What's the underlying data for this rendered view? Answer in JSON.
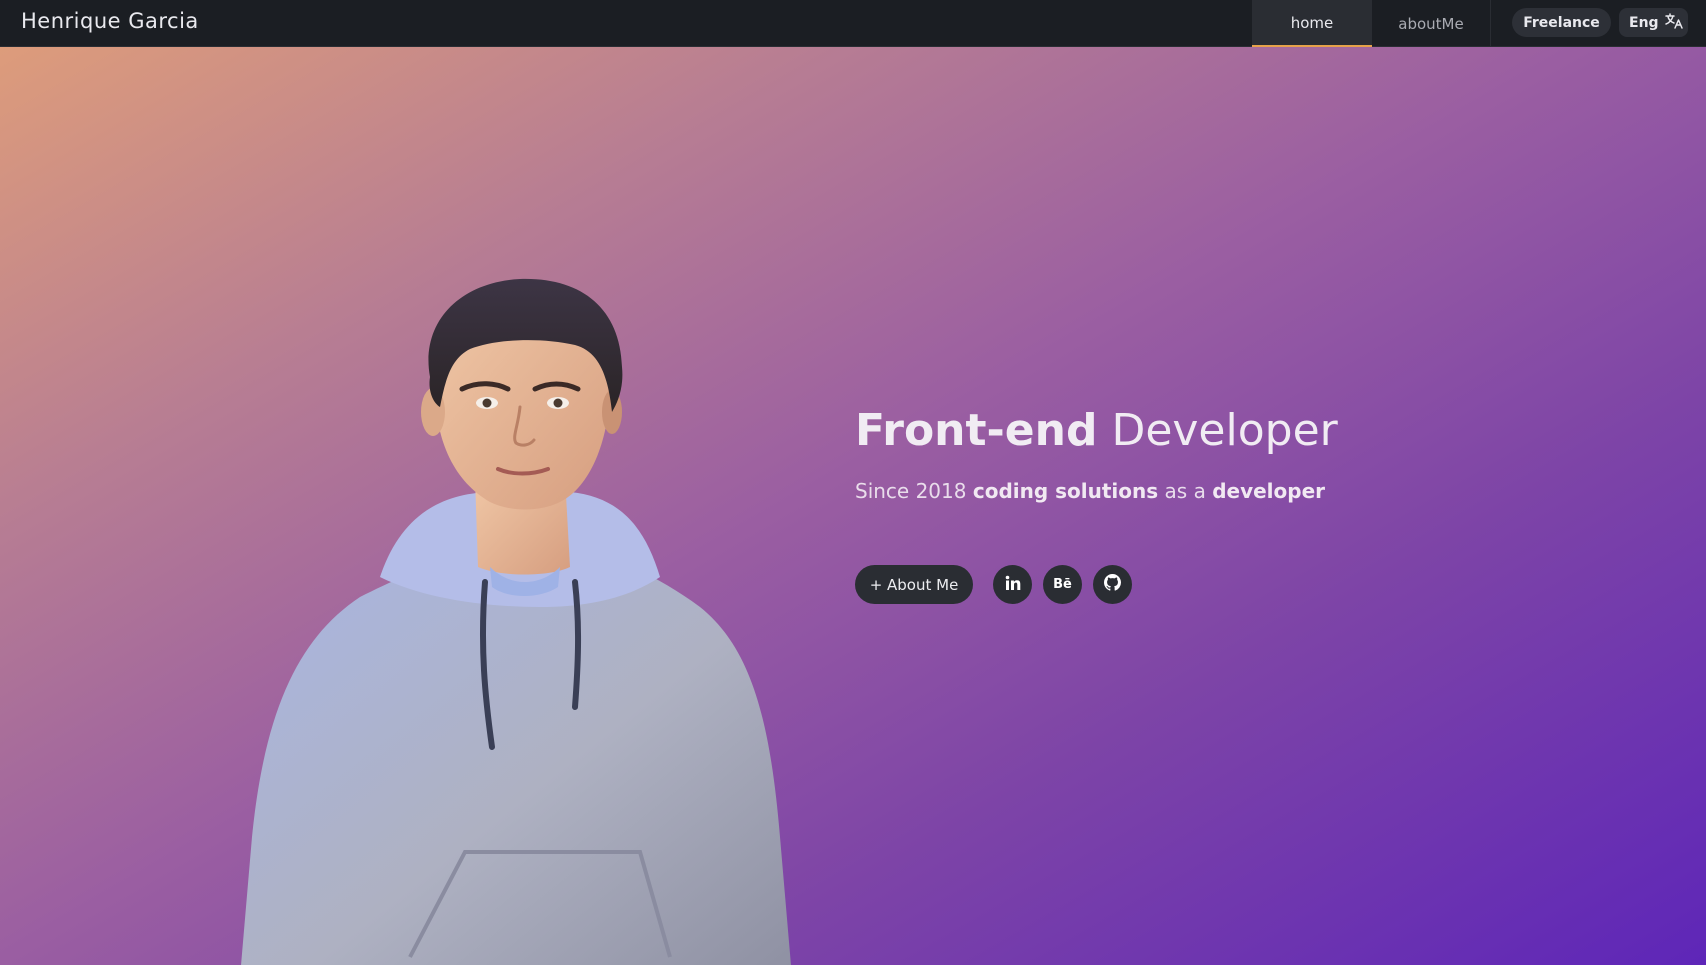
{
  "header": {
    "brand": "Henrique Garcia",
    "nav": {
      "home": "home",
      "about": "aboutMe"
    },
    "freelance_label": "Freelance",
    "language_label": "Eng"
  },
  "hero": {
    "title_bold": "Front-end",
    "title_light": " Developer",
    "subtitle": {
      "part1": "Since 2018 ",
      "part2": "coding solutions",
      "part3": " as a ",
      "part4": "developer"
    },
    "about_button": "+ About Me",
    "social": {
      "behance_label": "Bē"
    }
  },
  "icons": {
    "translate": "translate-icon",
    "linkedin": "linkedin-icon",
    "behance": "behance-icon",
    "github": "github-icon"
  },
  "colors": {
    "topbar": "#1b1e23",
    "accent": "#e6a24a",
    "button_bg": "#2a2d33",
    "gradient_start": "#dd9c7b",
    "gradient_end": "#5e26b8"
  }
}
